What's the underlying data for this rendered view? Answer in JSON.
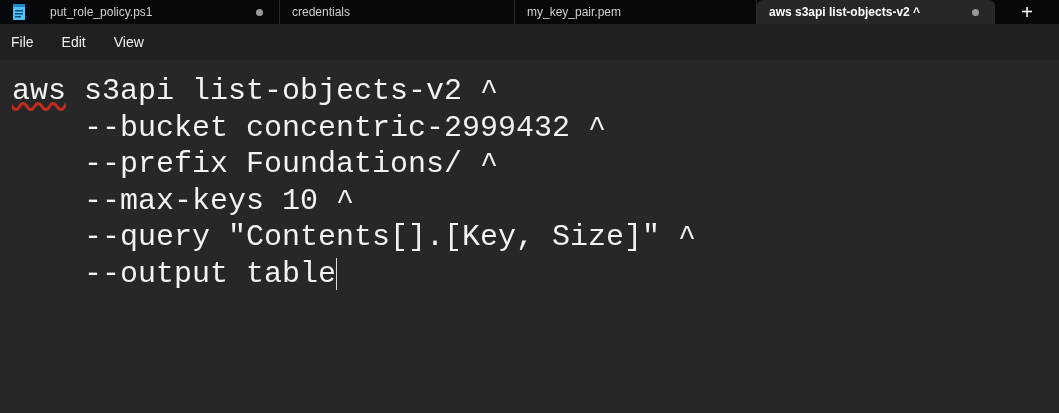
{
  "tabs": [
    {
      "label": "put_role_policy.ps1",
      "selected": false,
      "modified": true
    },
    {
      "label": "credentials",
      "selected": false,
      "modified": false
    },
    {
      "label": "my_key_pair.pem",
      "selected": false,
      "modified": false
    },
    {
      "label": "aws s3api list-objects-v2 ^",
      "selected": true,
      "modified": true
    }
  ],
  "new_tab_button": "+",
  "menu": [
    "File",
    "Edit",
    "View"
  ],
  "editor": {
    "lines": [
      {
        "segments": [
          {
            "text": "aws",
            "misspelled": true
          },
          {
            "text": " s3api list-objects-v2 ^",
            "misspelled": false
          }
        ]
      },
      {
        "segments": [
          {
            "text": "    --bucket concentric-2999432 ^",
            "misspelled": false
          }
        ]
      },
      {
        "segments": [
          {
            "text": "    --prefix Foundations/ ^",
            "misspelled": false
          }
        ]
      },
      {
        "segments": [
          {
            "text": "    --max-keys 10 ^",
            "misspelled": false
          }
        ]
      },
      {
        "segments": [
          {
            "text": "    --query \"Contents[].[Key, Size]\" ^",
            "misspelled": false
          }
        ]
      },
      {
        "segments": [
          {
            "text": "    --output table",
            "misspelled": false
          }
        ]
      }
    ],
    "caret_line_end": true
  }
}
